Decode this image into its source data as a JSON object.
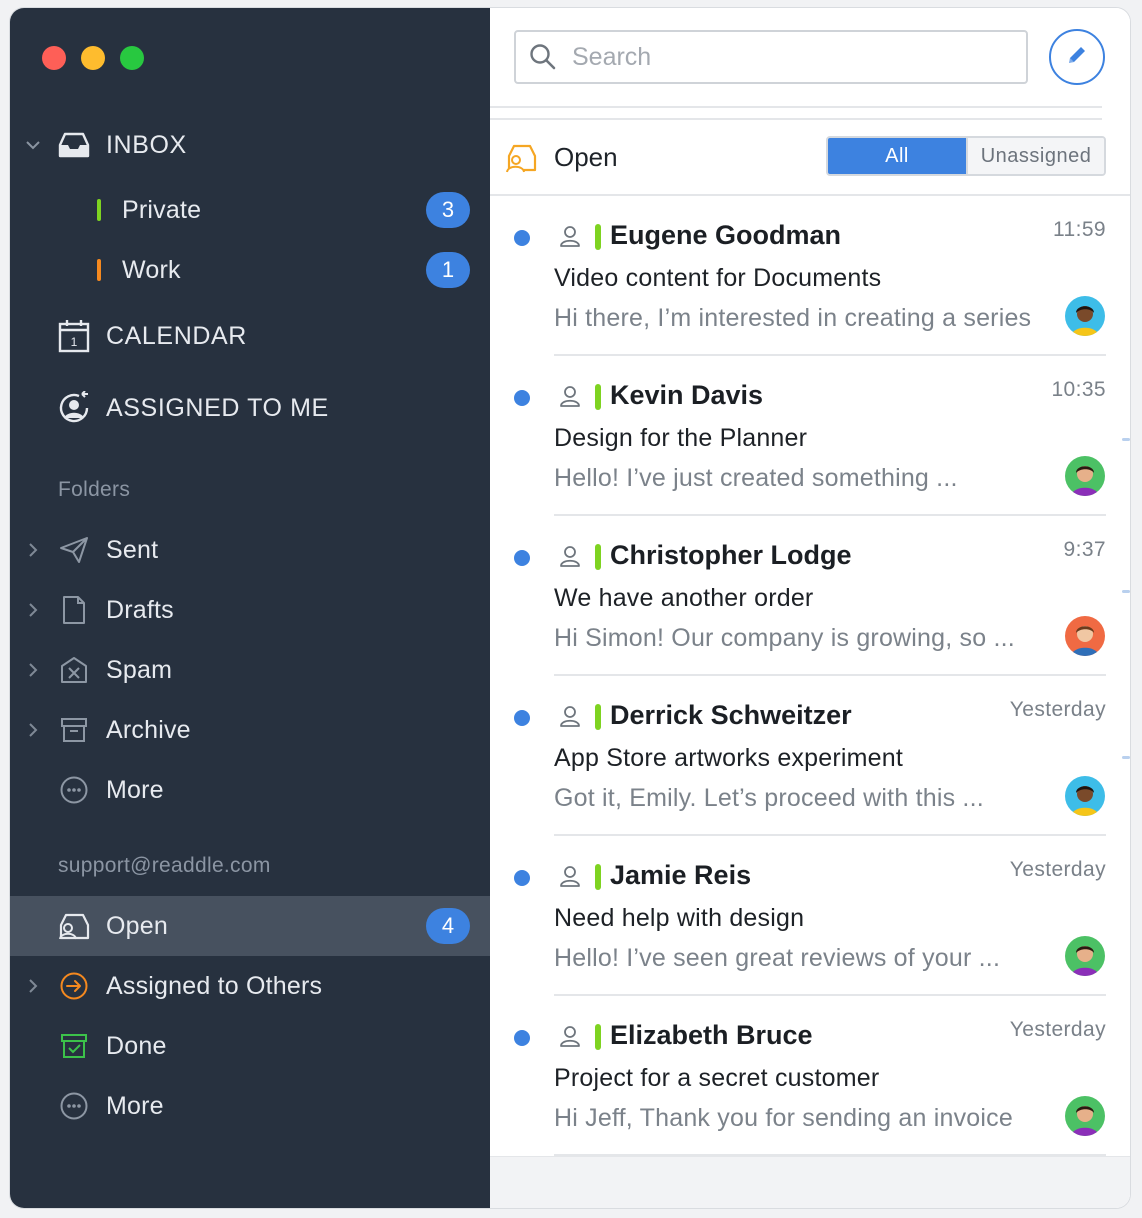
{
  "sidebar": {
    "inbox_label": "INBOX",
    "private_label": "Private",
    "private_count": "3",
    "work_label": "Work",
    "work_count": "1",
    "calendar_label": "CALENDAR",
    "calendar_day": "1",
    "assigned_label": "ASSIGNED TO ME",
    "folders_title": "Folders",
    "folders": [
      {
        "label": "Sent"
      },
      {
        "label": "Drafts"
      },
      {
        "label": "Spam"
      },
      {
        "label": "Archive"
      },
      {
        "label": "More"
      }
    ],
    "account_title": "support@readdle.com",
    "shared": {
      "open_label": "Open",
      "open_count": "4",
      "assigned_others_label": "Assigned to Others",
      "done_label": "Done",
      "more_label": "More"
    },
    "colors": {
      "private": "#7ed321",
      "work": "#f5891f",
      "badge": "#3d82e0"
    }
  },
  "toolbar": {
    "search_placeholder": "Search",
    "compose_icon": "pencil-icon"
  },
  "list_header": {
    "title": "Open",
    "filter_all": "All",
    "filter_unassigned": "Unassigned",
    "active_filter": "All"
  },
  "messages": [
    {
      "sender": "Eugene Goodman",
      "time": "11:59",
      "subject": "Video content for Documents",
      "preview": "Hi there, I’m interested in creating a series",
      "unread": true
    },
    {
      "sender": "Kevin Davis",
      "time": "10:35",
      "subject": "Design for the Planner",
      "preview": "Hello! I’ve just created something ...",
      "unread": true
    },
    {
      "sender": "Christopher Lodge",
      "time": "9:37",
      "subject": "We have another order",
      "preview": "Hi Simon! Our company is growing, so ...",
      "unread": true
    },
    {
      "sender": "Derrick Schweitzer",
      "time": "Yesterday",
      "subject": "App Store artworks experiment",
      "preview": "Got it, Emily. Let’s proceed with this ...",
      "unread": true
    },
    {
      "sender": "Jamie Reis",
      "time": "Yesterday",
      "subject": "Need help with design",
      "preview": "Hello! I’ve seen great reviews of your ...",
      "unread": true
    },
    {
      "sender": "Elizabeth Bruce",
      "time": "Yesterday",
      "subject": "Project for a secret customer",
      "preview": "Hi Jeff, Thank you for sending an invoice",
      "unread": true
    }
  ]
}
